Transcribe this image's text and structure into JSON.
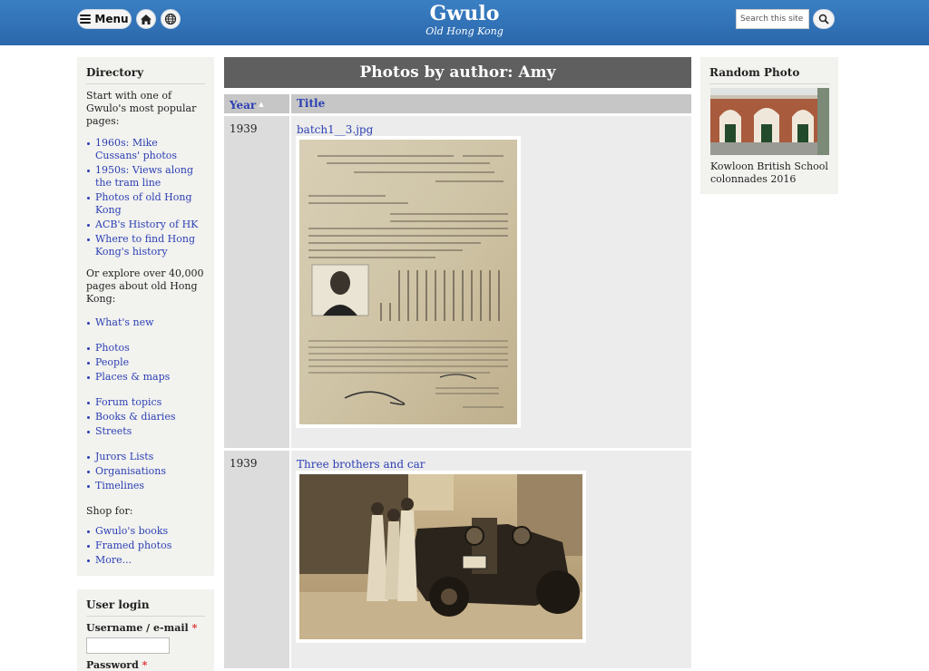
{
  "header": {
    "menu_label": "Menu",
    "site_name": "Gwulo",
    "site_slogan": "Old Hong Kong",
    "search_placeholder": "Search this site"
  },
  "sidebar": {
    "directory_title": "Directory",
    "intro": "Start with one of Gwulo's most popular pages:",
    "popular": [
      "1960s: Mike Cussans' photos",
      "1950s: Views along the tram line",
      "Photos of old Hong Kong",
      "ACB's History of HK",
      "Where to find Hong Kong's history"
    ],
    "explore_text": "Or explore over 40,000 pages about old Hong Kong:",
    "group1": [
      "What's new"
    ],
    "group2": [
      "Photos",
      "People",
      "Places & maps"
    ],
    "group3": [
      "Forum topics",
      "Books & diaries",
      "Streets"
    ],
    "group4": [
      "Jurors Lists",
      "Organisations",
      "Timelines"
    ],
    "shop_label": "Shop for:",
    "shop": [
      "Gwulo's books",
      "Framed photos",
      "More..."
    ]
  },
  "login": {
    "title": "User login",
    "username_label": "Username / e-mail",
    "password_label": "Password",
    "required_mark": "*"
  },
  "main": {
    "page_title": "Photos by author: Amy",
    "columns": [
      "Year",
      "Title"
    ],
    "rows": [
      {
        "year": "1939",
        "title": "batch1__3.jpg"
      },
      {
        "year": "1939",
        "title": "Three brothers and car"
      }
    ]
  },
  "random_photo": {
    "title": "Random Photo",
    "caption": "Kowloon British School colonnades 2016"
  },
  "colors": {
    "header_top": "#3a7fc3",
    "header_bottom": "#2b67ab",
    "link": "#2b3fb3",
    "title_bar": "#5f5f5f"
  }
}
